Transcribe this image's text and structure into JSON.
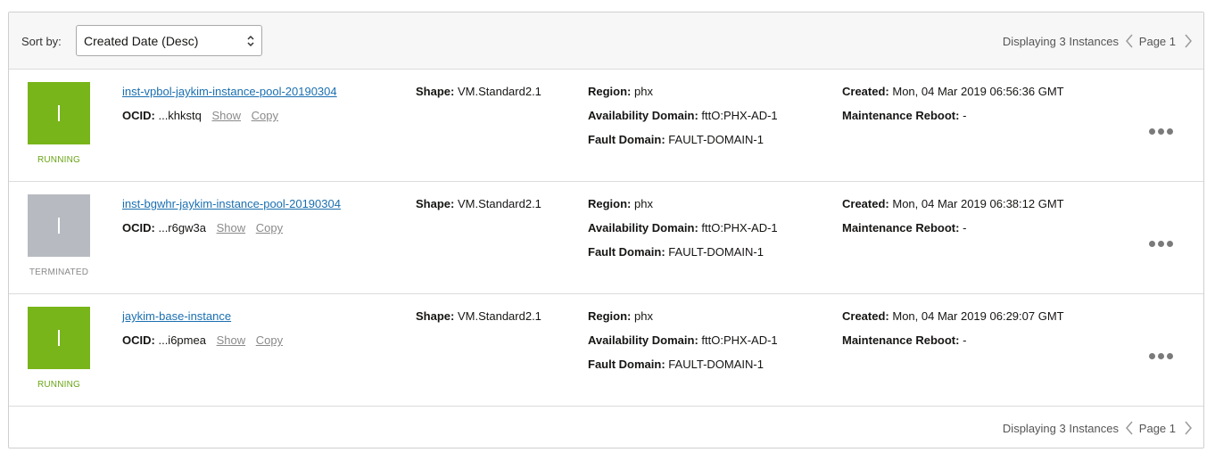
{
  "toolbar": {
    "sort_label": "Sort by:",
    "sort_value": "Created Date (Desc)",
    "pager_count": "Displaying 3 Instances",
    "pager_page": "Page 1"
  },
  "labels": {
    "ocid": "OCID:",
    "show": "Show",
    "copy": "Copy",
    "shape": "Shape:",
    "region": "Region:",
    "availability_domain": "Availability Domain:",
    "fault_domain": "Fault Domain:",
    "created": "Created:",
    "maintenance_reboot": "Maintenance Reboot:"
  },
  "colors": {
    "running": "#78b51a",
    "terminated": "#b7bbc1",
    "running_text": "#6aa516",
    "terminated_text": "#8a8a8a",
    "link": "#1a6fb0"
  },
  "instances": [
    {
      "name": "inst-vpbol-jaykim-instance-pool-20190304",
      "ocid_suffix": "...khkstq",
      "status": "RUNNING",
      "shape": "VM.Standard2.1",
      "region": "phx",
      "availability_domain": "fttO:PHX-AD-1",
      "fault_domain": "FAULT-DOMAIN-1",
      "created": "Mon, 04 Mar 2019 06:56:36 GMT",
      "maintenance_reboot": "-"
    },
    {
      "name": "inst-bgwhr-jaykim-instance-pool-20190304",
      "ocid_suffix": "...r6gw3a",
      "status": "TERMINATED",
      "shape": "VM.Standard2.1",
      "region": "phx",
      "availability_domain": "fttO:PHX-AD-1",
      "fault_domain": "FAULT-DOMAIN-1",
      "created": "Mon, 04 Mar 2019 06:38:12 GMT",
      "maintenance_reboot": "-"
    },
    {
      "name": "jaykim-base-instance",
      "ocid_suffix": "...i6pmea",
      "status": "RUNNING",
      "shape": "VM.Standard2.1",
      "region": "phx",
      "availability_domain": "fttO:PHX-AD-1",
      "fault_domain": "FAULT-DOMAIN-1",
      "created": "Mon, 04 Mar 2019 06:29:07 GMT",
      "maintenance_reboot": "-"
    }
  ],
  "footer": {
    "pager_count": "Displaying 3 Instances",
    "pager_page": "Page 1"
  },
  "icons": [
    "sort-chevron-icon",
    "chevron-left-icon",
    "chevron-right-icon",
    "instance-icon",
    "more-actions-icon"
  ]
}
